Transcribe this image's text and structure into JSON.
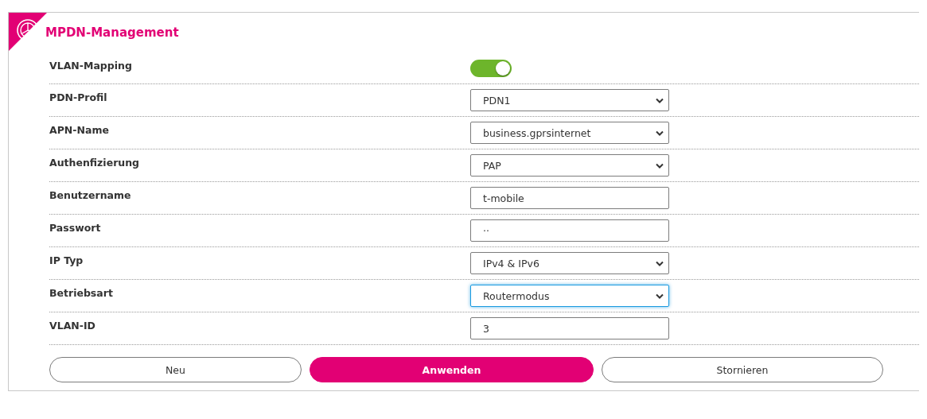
{
  "panel": {
    "title": "MPDN-Management"
  },
  "rows": [
    {
      "label": "VLAN-Mapping",
      "kind": "toggle",
      "on": true
    },
    {
      "label": "PDN-Profil",
      "kind": "select",
      "value": "PDN1",
      "focused": false
    },
    {
      "label": "APN-Name",
      "kind": "select",
      "value": "business.gprsinternet",
      "focused": false
    },
    {
      "label": "Authenfizierung",
      "kind": "select",
      "value": "PAP",
      "focused": false
    },
    {
      "label": "Benutzername",
      "kind": "text",
      "value": "t-mobile",
      "focused": false
    },
    {
      "label": "Passwort",
      "kind": "text",
      "value": "··",
      "focused": false
    },
    {
      "label": "IP Typ",
      "kind": "select",
      "value": "IPv4 & IPv6",
      "focused": false
    },
    {
      "label": "Betriebsart",
      "kind": "select",
      "value": "Routermodus",
      "focused": true
    },
    {
      "label": "VLAN-ID",
      "kind": "text",
      "value": "3",
      "focused": false
    }
  ],
  "buttons": [
    {
      "label": "Neu",
      "kind": "outline"
    },
    {
      "label": "Anwenden",
      "kind": "primary"
    },
    {
      "label": "Stornieren",
      "kind": "outline"
    }
  ]
}
